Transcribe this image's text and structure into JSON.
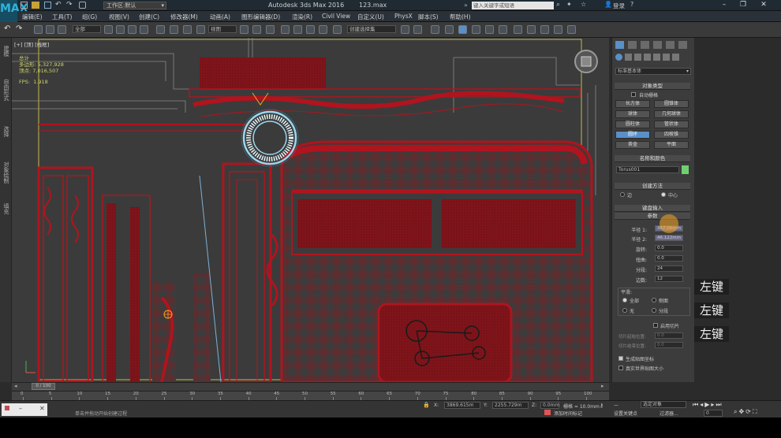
{
  "titlebar": {
    "app_title": "Autodesk 3ds Max 2016",
    "file_name": "123.max",
    "logo": "MAX",
    "workspace_prefix": "工作区:",
    "workspace": "默认",
    "search_placeholder": "键入关键字或短语",
    "login": "登录"
  },
  "menu": [
    "编辑(E)",
    "工具(T)",
    "组(G)",
    "视图(V)",
    "创建(C)",
    "修改器(M)",
    "动画(A)",
    "图形编辑器(D)",
    "渲染(R)",
    "Civil View",
    "自定义(U)",
    "PhysX",
    "脚本(S)",
    "帮助(H)"
  ],
  "toolbar": {
    "selection_filter": "全部",
    "ref_coord": "视图",
    "named_selection": "创建选择集"
  },
  "left_rail": [
    "建模",
    "自由形式",
    "选择",
    "对象绘制",
    "填充"
  ],
  "viewport": {
    "label": "[+] [顶] [线框]",
    "stats_title": "总计",
    "polys_label": "多边形:",
    "polys_value": "5,327,928",
    "verts_label": "顶点:",
    "verts_value": "7,016,507",
    "fps_label": "FPS:",
    "fps_value": "1.918"
  },
  "command_panel": {
    "type_dropdown": "标准基本体",
    "object_type_head": "对象类型",
    "autogrid": "自动栅格",
    "buttons": [
      {
        "label": "长方体",
        "active": false
      },
      {
        "label": "圆锥体",
        "active": false
      },
      {
        "label": "球体",
        "active": false
      },
      {
        "label": "几何球体",
        "active": false
      },
      {
        "label": "圆柱体",
        "active": false
      },
      {
        "label": "管状体",
        "active": false
      },
      {
        "label": "圆环",
        "active": true
      },
      {
        "label": "四棱锥",
        "active": false
      },
      {
        "label": "茶壶",
        "active": false
      },
      {
        "label": "平面",
        "active": false
      }
    ],
    "name_color_head": "名称和颜色",
    "object_name": "Torus001",
    "object_color": "#6fd06f",
    "creation_method_head": "创建方法",
    "method_edge": "边",
    "method_center": "中心",
    "keyboard_head": "键盘输入",
    "params_head": "参数",
    "params": [
      {
        "label": "半径 1:",
        "value": "367.06mm"
      },
      {
        "label": "半径 2:",
        "value": "46.122mm"
      },
      {
        "label": "旋转:",
        "value": "0.0"
      },
      {
        "label": "扭曲:",
        "value": "0.0"
      },
      {
        "label": "分段:",
        "value": "24"
      },
      {
        "label": "边数:",
        "value": "12"
      }
    ],
    "smooth_head": "平滑:",
    "smooth_all": "全部",
    "smooth_sides": "侧面",
    "smooth_none": "无",
    "smooth_segments": "分段",
    "slice_on": "启用切片",
    "slice_from_label": "切片起始位置:",
    "slice_from": "0.0",
    "slice_to_label": "切片结束位置:",
    "slice_to": "0.0",
    "gen_map": "生成贴图坐标",
    "real_world": "真实世界贴图大小"
  },
  "annotations": [
    "左键",
    "左键",
    "左键"
  ],
  "timeline": {
    "frame": "0 / 100",
    "ticks": [
      "0",
      "5",
      "10",
      "15",
      "20",
      "25",
      "30",
      "35",
      "40",
      "45",
      "50",
      "55",
      "60",
      "65",
      "70",
      "75",
      "80",
      "85",
      "90",
      "95",
      "100"
    ]
  },
  "status": {
    "x_label": "X:",
    "x_value": "3869.615m",
    "y_label": "Y:",
    "y_value": "2255.729m",
    "z_label": "Z:",
    "z_value": "0.0mm",
    "grid": "栅格 = 10.0mm",
    "add_time_tag": "添加时间标记",
    "set_key": "设置关键点",
    "selected": "选定对象",
    "filters": "过滤器...",
    "prompt": "单击并拖动开始创建过程",
    "frame_field": "0"
  },
  "colors": {
    "accent": "#5a8fc8",
    "cad_red": "#b0141e",
    "torus": "#9ad8ef"
  }
}
